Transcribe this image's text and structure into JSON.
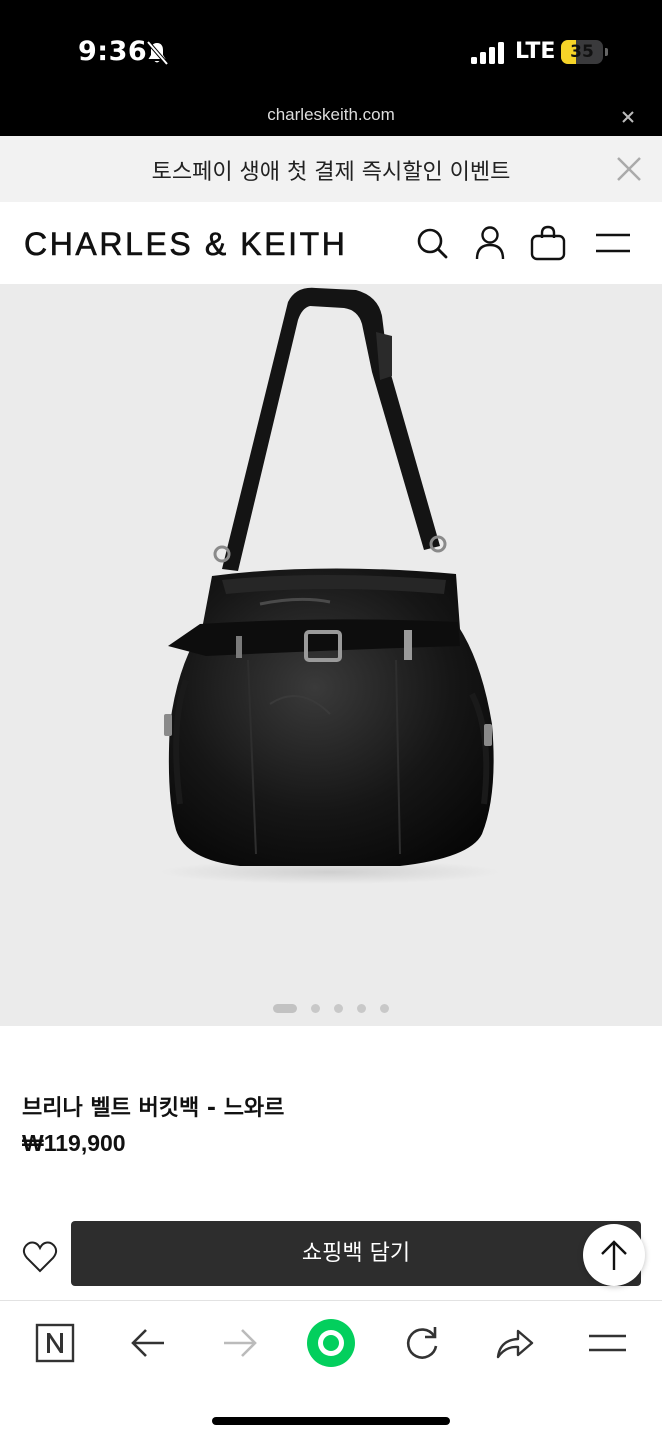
{
  "status_bar": {
    "time": "9:36",
    "network": "LTE",
    "battery_level": "35",
    "battery_fraction": 0.35,
    "icons": [
      "bell-slash-icon",
      "signal-icon"
    ]
  },
  "browser": {
    "url": "charleskeith.com",
    "close_icon": "close-icon"
  },
  "promo": {
    "text": "토스페이 생애 첫 결제 즉시할인 이벤트",
    "close_icon": "close-icon"
  },
  "header": {
    "logo": "CHARLES & KEITH",
    "icons": [
      "search-icon",
      "account-icon",
      "shopping-bag-icon",
      "menu-icon"
    ]
  },
  "gallery": {
    "image": "black-bucket-bag-photo",
    "slide_count": 5,
    "current_slide": 1,
    "colors": {
      "background": "#ebebeb"
    }
  },
  "product": {
    "name": "브리나 벨트 버킷백 - 느와르",
    "price": "₩119,900"
  },
  "actions": {
    "add_to_bag": "쇼핑백 담기",
    "wishlist_icon": "heart-icon",
    "scroll_top_icon": "arrow-up-icon",
    "colors": {
      "button": "#2d2d2d"
    }
  },
  "toolbar": {
    "items": [
      "naver-n-icon",
      "back-arrow-icon",
      "forward-arrow-icon",
      "green-circle-icon",
      "reload-icon",
      "share-icon",
      "hamburger-menu-icon"
    ],
    "colors": {
      "accent": "#03cf5d"
    }
  }
}
